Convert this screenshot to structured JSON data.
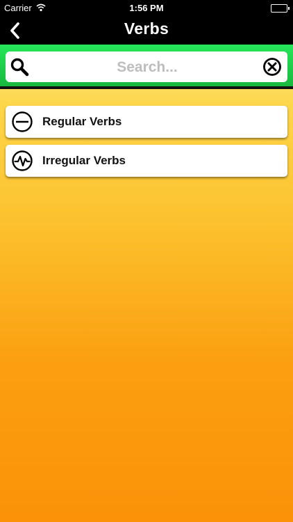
{
  "status_bar": {
    "carrier": "Carrier",
    "time": "1:56 PM"
  },
  "nav": {
    "title": "Verbs",
    "back_icon": "chevron-left-icon"
  },
  "search": {
    "placeholder": "Search...",
    "value": "",
    "search_icon": "magnifier-icon",
    "clear_icon": "circle-x-icon"
  },
  "list": {
    "items": [
      {
        "label": "Regular Verbs",
        "icon": "circle-minus-icon"
      },
      {
        "label": "Irregular Verbs",
        "icon": "circle-pulse-icon"
      }
    ]
  },
  "colors": {
    "search_bar_green": "#1fd04d",
    "background_top": "#fdf3b8",
    "background_bottom": "#fb9208"
  }
}
